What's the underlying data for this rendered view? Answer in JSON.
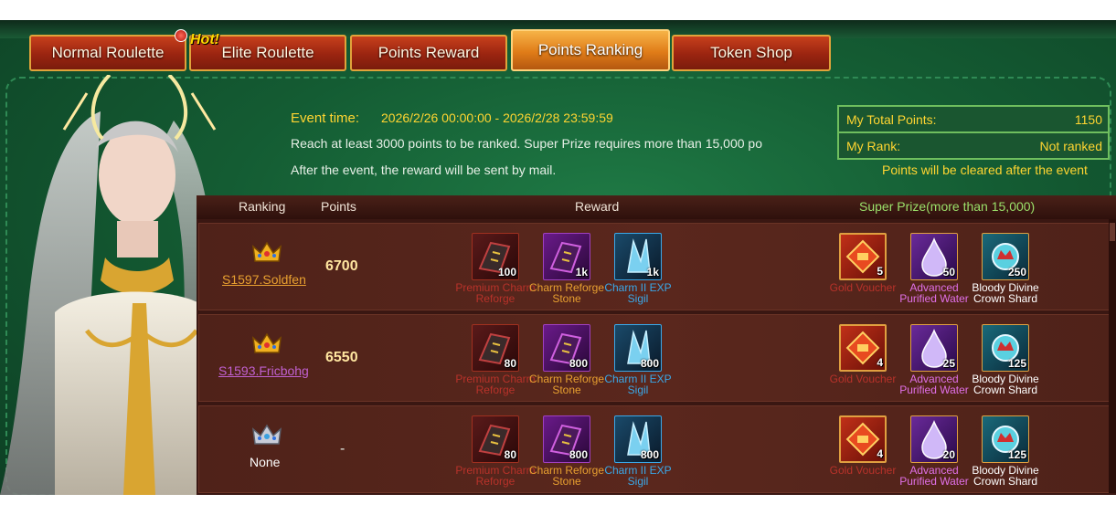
{
  "tabs": [
    {
      "label": "Normal Roulette",
      "active": false
    },
    {
      "label": "Elite Roulette",
      "active": false
    },
    {
      "label": "Points Reward",
      "active": false
    },
    {
      "label": "Points Ranking",
      "active": true
    },
    {
      "label": "Token Shop",
      "active": false
    }
  ],
  "hot_badge": "Hot!",
  "event": {
    "time_label": "Event time:",
    "time_value": "2026/2/26 00:00:00 - 2026/2/28 23:59:59",
    "rule": "Reach at least 3000 points to be ranked. Super Prize requires more than 15,000 po",
    "mail_note": "After the event, the reward will be sent by mail."
  },
  "stats": {
    "total_label": "My Total Points:",
    "total_value": "1150",
    "rank_label": "My Rank:",
    "rank_value": "Not ranked",
    "clear_note": "Points will be cleared after the event"
  },
  "table": {
    "headers": {
      "ranking": "Ranking",
      "points": "Points",
      "reward": "Reward",
      "super": "Super Prize(more than 15,000)"
    },
    "rows": [
      {
        "name": "S1597.Soldfen",
        "points": "6700",
        "crown": "gold",
        "rewards": [
          {
            "count": "100",
            "label": "Premium Charm Reforge"
          },
          {
            "count": "1k",
            "label": "Charm Reforge Stone"
          },
          {
            "count": "1k",
            "label": "Charm II EXP Sigil"
          }
        ],
        "super": [
          {
            "count": "5",
            "label": "Gold Voucher"
          },
          {
            "count": "50",
            "label": "Advanced Purified Water"
          },
          {
            "count": "250",
            "label": "Bloody Divine Crown Shard"
          }
        ]
      },
      {
        "name": "S1593.Fricbohg",
        "points": "6550",
        "crown": "gold",
        "rewards": [
          {
            "count": "80",
            "label": "Premium Charm Reforge"
          },
          {
            "count": "800",
            "label": "Charm Reforge Stone"
          },
          {
            "count": "800",
            "label": "Charm II EXP Sigil"
          }
        ],
        "super": [
          {
            "count": "4",
            "label": "Gold Voucher"
          },
          {
            "count": "25",
            "label": "Advanced Purified Water"
          },
          {
            "count": "125",
            "label": "Bloody Divine Crown Shard"
          }
        ]
      },
      {
        "name": "None",
        "points": "-",
        "crown": "silver",
        "rewards": [
          {
            "count": "80",
            "label": "Premium Charm Reforge"
          },
          {
            "count": "800",
            "label": "Charm Reforge Stone"
          },
          {
            "count": "800",
            "label": "Charm II EXP Sigil"
          }
        ],
        "super": [
          {
            "count": "4",
            "label": "Gold Voucher"
          },
          {
            "count": "20",
            "label": "Advanced Purified Water"
          },
          {
            "count": "125",
            "label": "Bloody Divine Crown Shard"
          }
        ]
      }
    ]
  },
  "colors": {
    "gold_text": "#ffd531",
    "name_link_1": "#e8a030",
    "name_link_2": "#c060d0",
    "label_red": "#b8322a",
    "label_orange": "#e8a030",
    "label_blue": "#3aa8e8",
    "label_pink": "#e070e8",
    "label_white": "#ffffff"
  }
}
